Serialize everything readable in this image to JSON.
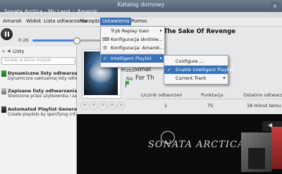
{
  "window": {
    "title": "Katalog domowy",
    "subtitle": "Sonata Arctica - My Land  ::  Amarok",
    "close_glyph": "×"
  },
  "menubar": {
    "items": [
      "Amarok",
      "Widok",
      "Lista odtwarzania",
      "Narzędzia",
      "Ustawienia",
      "Pomoc"
    ]
  },
  "player": {
    "time": "0:26",
    "progress_fraction": 0.58,
    "now_playing": "The Sake Of Revenge"
  },
  "left_panel": {
    "close_glyph": "×",
    "title": "Listy",
    "search_placeholder": "Szukaj w liście muzyki",
    "items": [
      {
        "title": "Dynamiczne listy odtwarzania",
        "subtitle": "Dynamiczne uaktualniaj listy odtw"
      },
      {
        "title": "Zapisane listy odtwarzania",
        "subtitle": "Stworzone przez użytkownika i zap"
      },
      {
        "title": "Automated Playlist Generator",
        "subtitle": "Create playlists by specifying crit"
      }
    ]
  },
  "track": {
    "by_label": "Przez",
    "artist": "Sonat",
    "on_label": "Na",
    "album": "For Th"
  },
  "rating": {
    "stars": 0,
    "max": 5,
    "star_glyph": "★"
  },
  "stats": {
    "headers": [
      "Licznik odtworzeń",
      "Punktacja",
      "Ostatnio odtwarzane"
    ],
    "values": [
      "1",
      "75",
      "18 minut temu"
    ]
  },
  "album_art_text": "SONATA ARCTICA",
  "menu": {
    "items": [
      {
        "label": "Tryb Replay Gain",
        "has_submenu": true,
        "icon": "replay-gain-icon",
        "glyph": ""
      },
      {
        "label": "Konfiguracja skrótów...",
        "has_submenu": false,
        "icon": "keyboard-icon",
        "glyph": "⌨"
      },
      {
        "label": "Konfiguracja: Amarok...",
        "has_submenu": false,
        "icon": "settings-icon",
        "glyph": "⚙"
      },
      {
        "label": "Intelligent Playlist",
        "has_submenu": true,
        "icon": "playlist-icon",
        "glyph": "✓",
        "selected": true
      }
    ],
    "submenu_arrow": "▸"
  },
  "submenu": {
    "items": [
      {
        "label": "Configure ...",
        "checked": false,
        "has_submenu": false
      },
      {
        "label": "Enable Intelligent Playlist",
        "checked": true,
        "has_submenu": false
      },
      {
        "label": "Current Track",
        "checked": false,
        "has_submenu": true
      }
    ],
    "check_glyph": "✓"
  },
  "colors": {
    "accent": "#3a72b8",
    "titlebar": "#5a6878",
    "dark_panel": "#0a0a0a"
  }
}
